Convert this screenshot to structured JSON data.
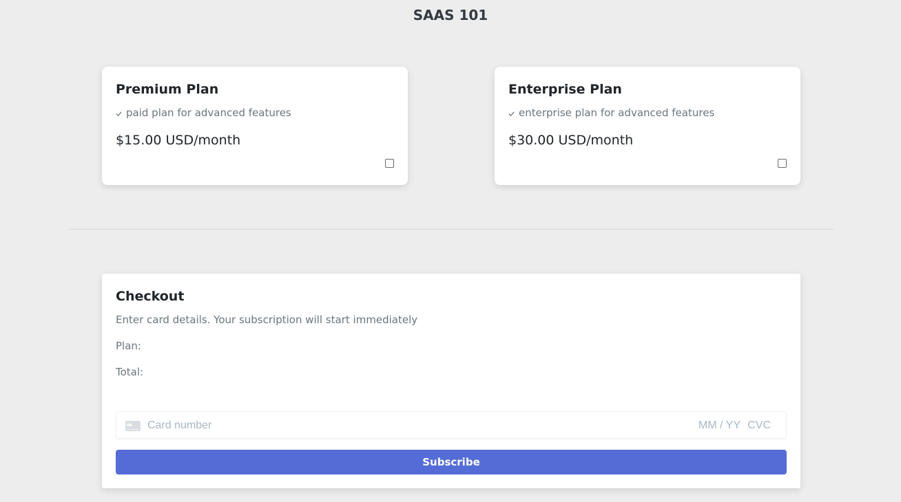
{
  "app": {
    "title": "SAAS 101"
  },
  "plans": [
    {
      "title": "Premium Plan",
      "description": "paid plan for advanced features",
      "price": "$15.00 USD/month",
      "checked": false
    },
    {
      "title": "Enterprise Plan",
      "description": "enterprise plan for advanced features",
      "price": "$30.00 USD/month",
      "checked": false
    }
  ],
  "checkout": {
    "title": "Checkout",
    "description": "Enter card details. Your subscription will start immediately",
    "plan_label": "Plan:",
    "total_label": "Total:",
    "card": {
      "number_placeholder": "Card number",
      "expiry_placeholder": "MM / YY",
      "cvc_placeholder": "CVC"
    },
    "subscribe_label": "Subscribe"
  },
  "colors": {
    "background": "#ededed",
    "accent": "#556cd6",
    "placeholder": "#aab7c4"
  }
}
